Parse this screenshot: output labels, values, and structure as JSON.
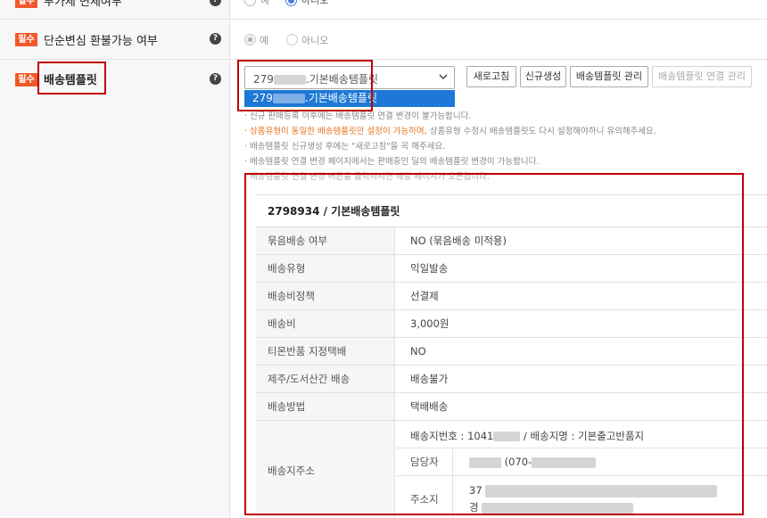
{
  "rows": {
    "top_partial": {
      "badge": "필수",
      "label": "부가세 면세여부",
      "options": [
        "예",
        "아니오"
      ]
    },
    "refund": {
      "badge": "필수",
      "label": "단순변심 환불가능 여부",
      "options": [
        "예",
        "아니오"
      ]
    },
    "delivery_template": {
      "badge": "필수",
      "label": "배송템플릿"
    }
  },
  "select": {
    "value_prefix": "279",
    "value_suffix": ".기본배송템플릿",
    "option_prefix": "279",
    "option_suffix": ".기본배송템플릿"
  },
  "buttons": {
    "refresh": "새로고침",
    "create": "신규생성",
    "manage": "배송템플릿 관리",
    "connect": "배송템플릿 연결 관리"
  },
  "notes": [
    {
      "plain": "· 신규 판매등록 이후에는 배송템플릿 연결 변경이 불가능합니다."
    },
    {
      "orange": "· 상품유형이 동일한 배송템플릿만 설정이 가능하며,",
      "plain": " 상품유형 수정시 배송템플릿도 다시 설정해야하니 유의해주세요."
    },
    {
      "plain": "· 배송템플릿 신규생성 후에는 \"새로고침\"을 꼭 해주세요."
    },
    {
      "plain": "· 배송템플릿 연결 변경 페이지에서는 판매중인 딜의 배송템플릿 변경이 가능합니다."
    },
    {
      "plain": "· 배송템플릿 연결 변경 버튼을 클릭하시면 해당 페이지가 오픈됩니다."
    }
  ],
  "template_detail": {
    "title": "2798934 / 기본배송템플릿",
    "rows": [
      {
        "key": "묶음배송 여부",
        "value": "NO (묶음배송 미적용)"
      },
      {
        "key": "배송유형",
        "value": "익일발송"
      },
      {
        "key": "배송비정책",
        "value": "선결제"
      },
      {
        "key": "배송비",
        "value": "3,000원"
      },
      {
        "key": "티몬반품 지정택배",
        "value": "NO"
      },
      {
        "key": "제주/도서산간 배송",
        "value": "배송불가"
      },
      {
        "key": "배송방법",
        "value": "택배배송"
      }
    ],
    "address": {
      "key": "배송지주소",
      "line1_prefix": "배송지번호 : 1041",
      "line1_suffix": " / 배송지명 : 기본출고반품지",
      "manager_key": "담당자",
      "manager_phone_prefix": "(070-",
      "location_key": "주소지",
      "location_prefix1": "37",
      "location_prefix2": "경"
    }
  },
  "colors": {
    "required_badge": "#f1592a",
    "highlight_red": "#c00000",
    "dropdown_selected": "#1e78d7",
    "note_orange": "#e8731e"
  }
}
